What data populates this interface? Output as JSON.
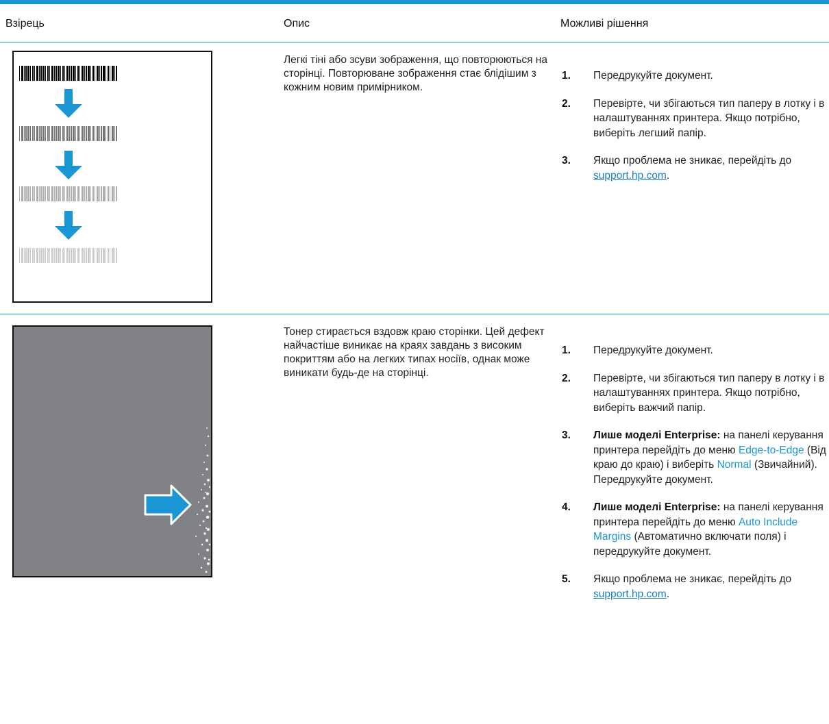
{
  "header": {
    "col_sample": "Взірець",
    "col_description": "Опис",
    "col_solutions": "Можливі рішення"
  },
  "rows": [
    {
      "description": "Легкі тіні або зсуви зображення, що повторюються на сторінці. Повторюване зображення стає блідішим з кожним новим примірником.",
      "steps": [
        {
          "num": "1.",
          "text": "Передрукуйте документ."
        },
        {
          "num": "2.",
          "text": "Перевірте, чи збігаються тип паперу в лотку і в налаштуваннях принтера. Якщо потрібно, виберіть легший папір."
        },
        {
          "num": "3.",
          "pre": "Якщо проблема не зникає, перейдіть до ",
          "link": "support.hp.com",
          "post": "."
        }
      ]
    },
    {
      "description": "Тонер стирається вздовж краю сторінки. Цей дефект найчастіше виникає на краях завдань з високим покриттям або на легких типах носіїв, однак може виникати будь-де на сторінці.",
      "steps": [
        {
          "num": "1.",
          "text": "Передрукуйте документ."
        },
        {
          "num": "2.",
          "text": "Перевірте, чи збігаються тип паперу в лотку і в налаштуваннях принтера. Якщо потрібно, виберіть важчий папір."
        },
        {
          "num": "3.",
          "bold": "Лише моделі Enterprise:",
          "a": " на панелі керування принтера перейдіть до меню ",
          "menu": "Edge-to-Edge",
          "b": " (Від краю до краю) і виберіть ",
          "menu2": "Normal",
          "c": " (Звичайний). Передрукуйте документ."
        },
        {
          "num": "4.",
          "bold": "Лише моделі Enterprise:",
          "a": " на панелі керування принтера перейдіть до меню ",
          "menu": "Auto Include Margins",
          "b": " (Автоматично включати поля) і передрукуйте документ."
        },
        {
          "num": "5.",
          "pre": "Якщо проблема не зникає, перейдіть до ",
          "link": "support.hp.com",
          "post": "."
        }
      ]
    }
  ],
  "colors": {
    "accent": "#1a96d4",
    "sample_gray": "#808285"
  }
}
